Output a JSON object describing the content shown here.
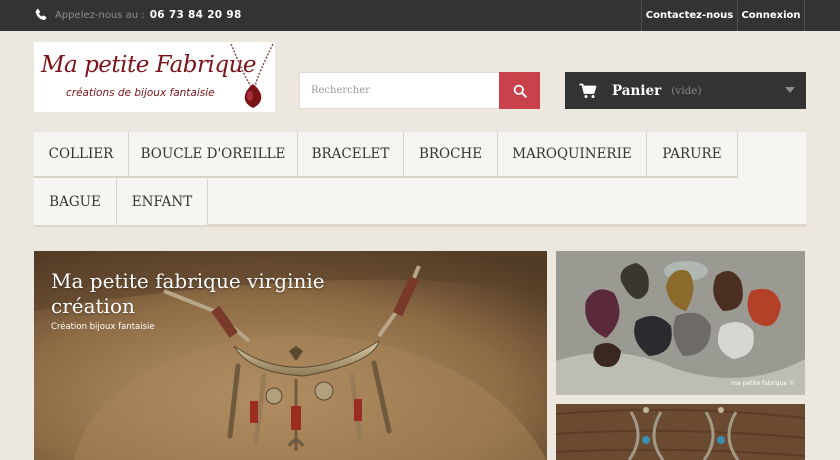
{
  "topbar": {
    "phone_label": "Appelez-nous au :",
    "phone_number": "06 73 84 20 98",
    "contact_label": "Contactez-nous",
    "login_label": "Connexion"
  },
  "logo": {
    "title": "Ma petite Fabrique",
    "subtitle": "créations de bijoux fantaisie"
  },
  "search": {
    "placeholder": "Rechercher"
  },
  "cart": {
    "label": "Panier",
    "status": "(vide)"
  },
  "nav": {
    "items": [
      "COLLIER",
      "BOUCLE D'OREILLE",
      "BRACELET",
      "BROCHE",
      "MAROQUINERIE",
      "PARURE",
      "BAGUE",
      "ENFANT"
    ]
  },
  "slider": {
    "title": "Ma petite fabrique virginie création",
    "subtitle": "Création bijoux fantaisie"
  },
  "banner1": {
    "caption": "ma petite fabrique ©"
  },
  "colors": {
    "topbar": "#333333",
    "accent": "#c8414b",
    "logo_red": "#7b1218"
  }
}
